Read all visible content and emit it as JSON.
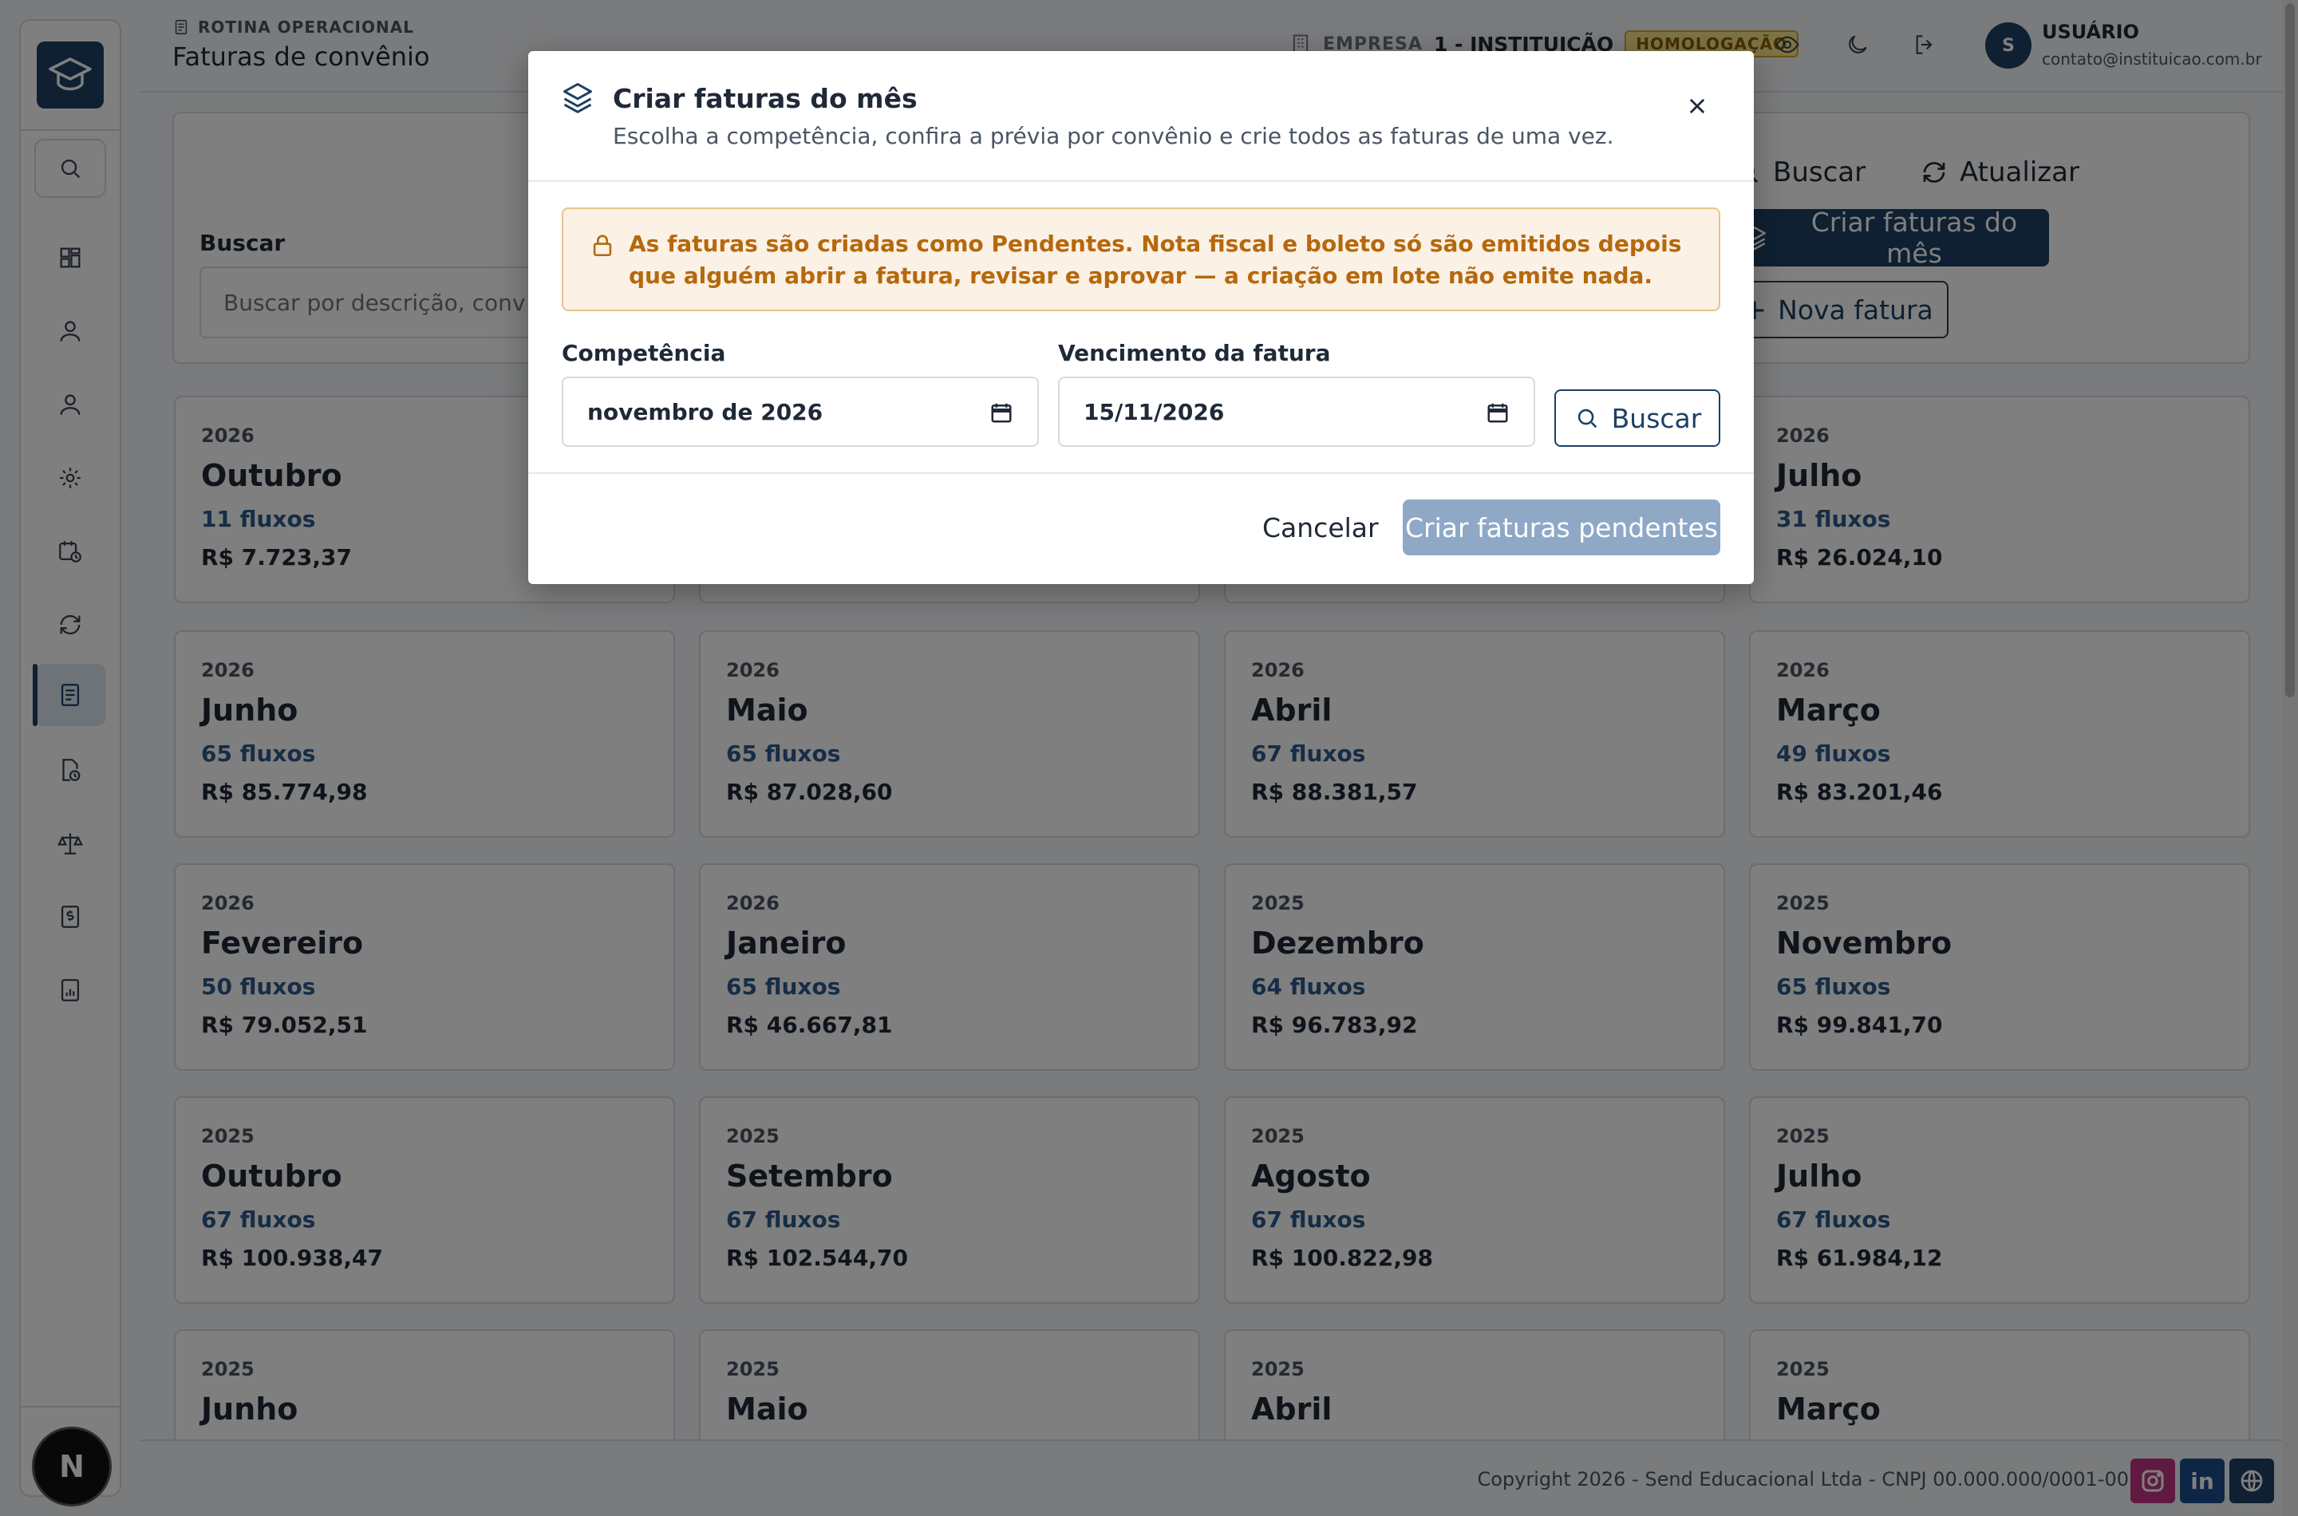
{
  "header": {
    "breadcrumb": "ROTINA OPERACIONAL",
    "title": "Faturas de convênio",
    "company_label": "EMPRESA",
    "company_value": "1 - INSTITUIÇÃO",
    "env_badge": "HOMOLOGAÇÃO",
    "user_initial": "S",
    "user_name": "USUÁRIO",
    "user_email": "contato@instituicao.com.br"
  },
  "sidebar": {
    "items": [
      "search-icon",
      "dashboard-icon",
      "user-icon",
      "user-icon",
      "gear-icon",
      "calendar-clock-icon",
      "refresh-icon",
      "document-icon",
      "file-clock-icon",
      "scale-icon",
      "dollar-doc-icon",
      "report-icon"
    ],
    "active_index": 7,
    "badge": "N"
  },
  "filters": {
    "search_label": "Buscar",
    "search_placeholder": "Buscar por descrição, conv",
    "buscar_button": "Buscar",
    "atualizar_button": "Atualizar",
    "criar_button": "Criar faturas do mês",
    "nova_button": "Nova fatura"
  },
  "cards": [
    {
      "year": "2026",
      "month": "Outubro",
      "flows": "11 fluxos",
      "amount": "R$ 7.723,37"
    },
    {
      "year": "",
      "month": "",
      "flows": "",
      "amount": ""
    },
    {
      "year": "",
      "month": "",
      "flows": "",
      "amount": ""
    },
    {
      "year": "2026",
      "month": "Julho",
      "flows": "31 fluxos",
      "amount": "R$ 26.024,10"
    },
    {
      "year": "2026",
      "month": "Junho",
      "flows": "65 fluxos",
      "amount": "R$ 85.774,98"
    },
    {
      "year": "2026",
      "month": "Maio",
      "flows": "65 fluxos",
      "amount": "R$ 87.028,60"
    },
    {
      "year": "2026",
      "month": "Abril",
      "flows": "67 fluxos",
      "amount": "R$ 88.381,57"
    },
    {
      "year": "2026",
      "month": "Março",
      "flows": "49 fluxos",
      "amount": "R$ 83.201,46"
    },
    {
      "year": "2026",
      "month": "Fevereiro",
      "flows": "50 fluxos",
      "amount": "R$ 79.052,51"
    },
    {
      "year": "2026",
      "month": "Janeiro",
      "flows": "65 fluxos",
      "amount": "R$ 46.667,81"
    },
    {
      "year": "2025",
      "month": "Dezembro",
      "flows": "64 fluxos",
      "amount": "R$ 96.783,92"
    },
    {
      "year": "2025",
      "month": "Novembro",
      "flows": "65 fluxos",
      "amount": "R$ 99.841,70"
    },
    {
      "year": "2025",
      "month": "Outubro",
      "flows": "67 fluxos",
      "amount": "R$ 100.938,47"
    },
    {
      "year": "2025",
      "month": "Setembro",
      "flows": "67 fluxos",
      "amount": "R$ 102.544,70"
    },
    {
      "year": "2025",
      "month": "Agosto",
      "flows": "67 fluxos",
      "amount": "R$ 100.822,98"
    },
    {
      "year": "2025",
      "month": "Julho",
      "flows": "67 fluxos",
      "amount": "R$ 61.984,12"
    },
    {
      "year": "2025",
      "month": "Junho",
      "flows": "",
      "amount": ""
    },
    {
      "year": "2025",
      "month": "Maio",
      "flows": "",
      "amount": ""
    },
    {
      "year": "2025",
      "month": "Abril",
      "flows": "",
      "amount": ""
    },
    {
      "year": "2025",
      "month": "Março",
      "flows": "",
      "amount": ""
    }
  ],
  "footer": {
    "copyright": "Copyright 2026 - Send Educacional Ltda - CNPJ 00.000.000/0001-00",
    "social": [
      "instagram-icon",
      "linkedin-icon",
      "globe-icon"
    ]
  },
  "modal": {
    "title": "Criar faturas do mês",
    "subtitle": "Escolha a competência, confira a prévia por convênio e crie todos as faturas de uma vez.",
    "alert": "As faturas são criadas como Pendentes. Nota fiscal e boleto só são emitidos depois que alguém abrir a fatura, revisar e aprovar — a criação em lote não emite nada.",
    "competencia_label": "Competência",
    "competencia_value": "novembro de 2026",
    "vencimento_label": "Vencimento da fatura",
    "vencimento_value": "15/11/2026",
    "search_button": "Buscar",
    "cancel_button": "Cancelar",
    "create_button": "Criar faturas pendentes"
  },
  "colors": {
    "primary": "#1c4063",
    "accent_text": "#2d5b8a",
    "alert_bg": "#fbf1e4",
    "alert_text": "#b5680d",
    "badge_bg": "#fde68a",
    "create_disabled": "#8ea8c6"
  }
}
